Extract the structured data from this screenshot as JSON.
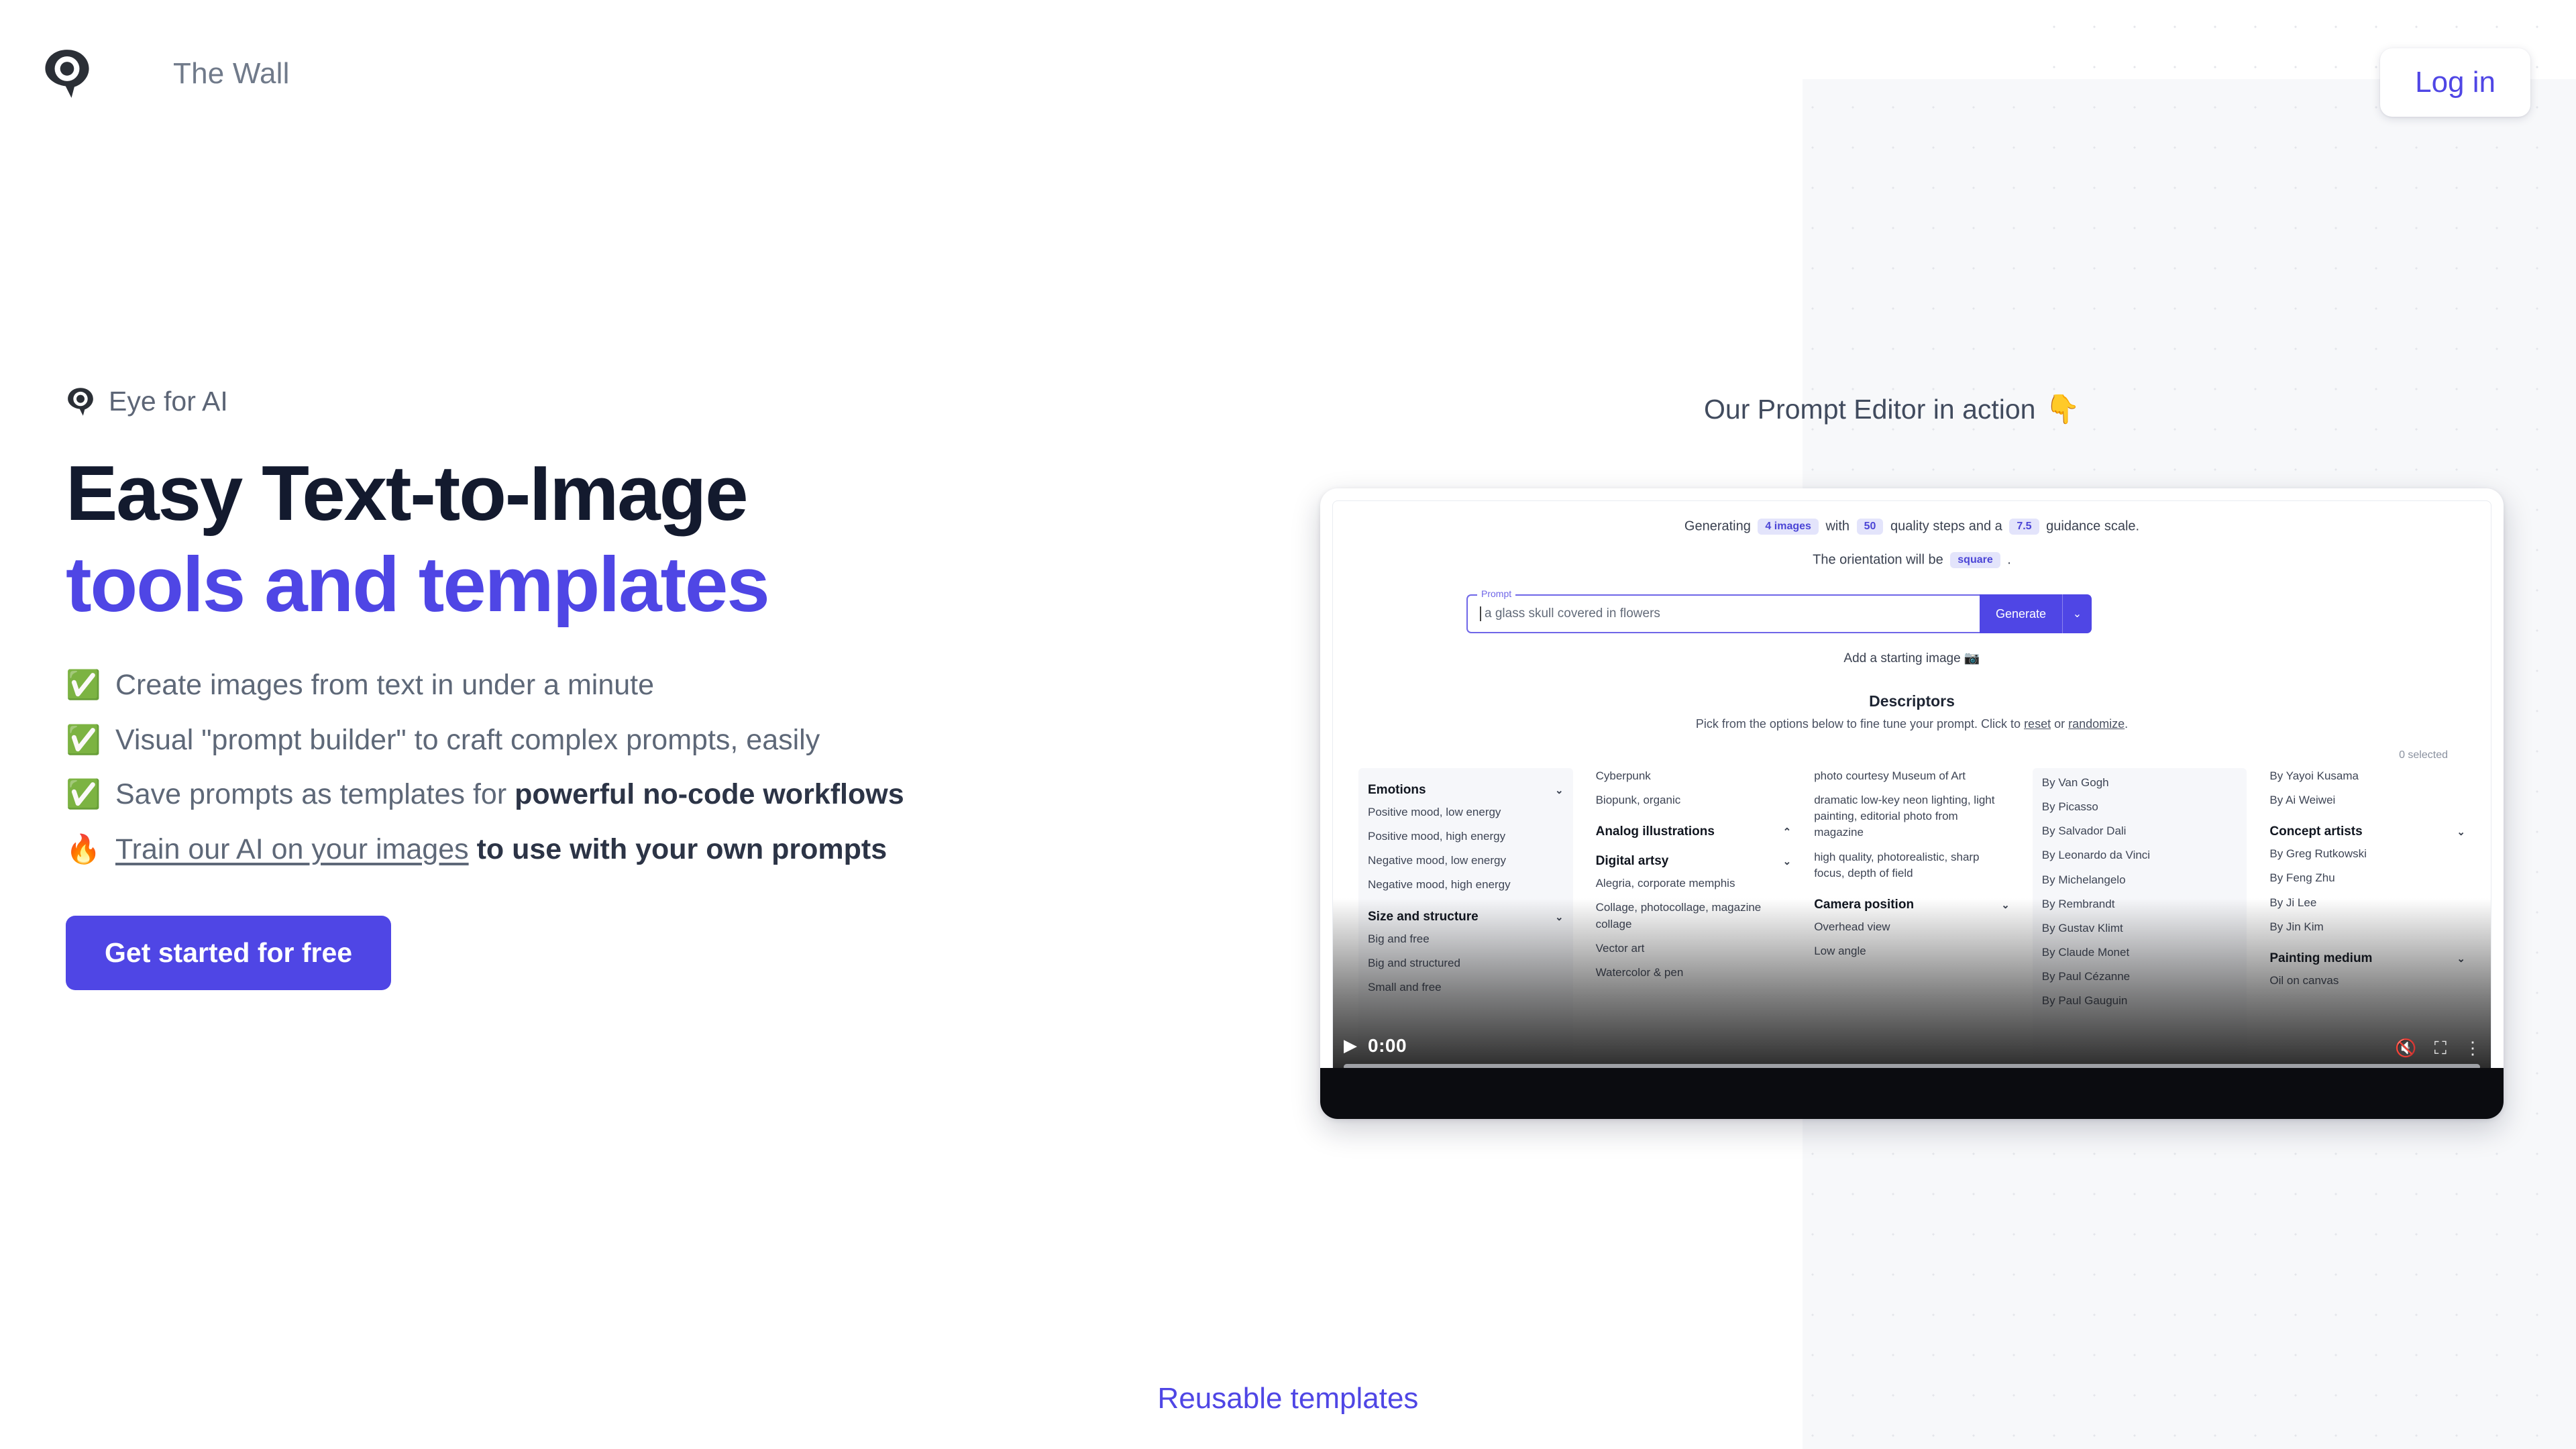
{
  "header": {
    "brand_name": "The Wall",
    "logo_icon": "eye-logo-icon",
    "login_label": "Log in"
  },
  "hero": {
    "eyebrow": "Eye for AI",
    "headline_line1": "Easy Text-to-Image",
    "headline_line2": "tools and templates",
    "bullets": [
      {
        "mark": "✅",
        "mark_icon": "check-mark-icon",
        "html": "Create images from text in under a minute"
      },
      {
        "mark": "✅",
        "mark_icon": "check-mark-icon",
        "html": "Visual \"prompt builder\" to craft complex prompts, easily"
      },
      {
        "mark": "✅",
        "mark_icon": "check-mark-icon",
        "html": "Save prompts as templates for <b>powerful no-code workflows</b>"
      },
      {
        "mark": "🔥",
        "mark_icon": "fire-icon",
        "html": "<u>Train our AI on your images</u> <b>to use with your own prompts</b>"
      }
    ],
    "cta_label": "Get started for free"
  },
  "video": {
    "caption": "Our Prompt Editor in action",
    "caption_pointer": "👇",
    "time": "0:00",
    "play_icon": "play-icon",
    "mute_icon": "mute-icon",
    "fullscreen_icon": "fullscreen-icon",
    "more_icon": "more-vertical-icon",
    "editor": {
      "gen_pre": "Generating",
      "gen_images": "4 images",
      "gen_mid": "with",
      "gen_steps": "50",
      "gen_post": "quality steps and a",
      "gen_guidance": "7.5",
      "gen_end": "guidance scale.",
      "orient_pre": "The orientation will be",
      "orient_value": "square",
      "orient_end": ".",
      "prompt_label": "Prompt",
      "prompt_value": "a glass skull covered in flowers",
      "generate_label": "Generate",
      "generate_caret": "⌄",
      "starting_image": "Add a starting image 📷",
      "descriptors_title": "Descriptors",
      "descriptors_sub_pre": "Pick from the options below to fine tune your prompt. Click to ",
      "descriptors_reset": "reset",
      "descriptors_or": " or ",
      "descriptors_randomize": "randomize",
      "descriptors_end": ".",
      "selected_count": "0 selected",
      "columns": [
        {
          "shaded": true,
          "blocks": [
            {
              "type": "group",
              "label": "Emotions",
              "chev": "⌄"
            },
            {
              "type": "opt",
              "label": "Positive mood, low energy"
            },
            {
              "type": "opt",
              "label": "Positive mood, high energy"
            },
            {
              "type": "opt",
              "label": "Negative mood, low energy"
            },
            {
              "type": "opt",
              "label": "Negative mood, high energy"
            },
            {
              "type": "group",
              "label": "Size and structure",
              "chev": "⌄"
            },
            {
              "type": "opt",
              "label": "Big and free"
            },
            {
              "type": "opt",
              "label": "Big and structured"
            },
            {
              "type": "opt",
              "label": "Small and free"
            }
          ]
        },
        {
          "shaded": false,
          "blocks": [
            {
              "type": "opt",
              "label": "Cyberpunk"
            },
            {
              "type": "opt",
              "label": "Biopunk, organic"
            },
            {
              "type": "group",
              "label": "Analog illustrations",
              "chev": "⌃"
            },
            {
              "type": "group",
              "label": "Digital artsy",
              "chev": "⌄"
            },
            {
              "type": "opt",
              "label": "Alegria, corporate memphis"
            },
            {
              "type": "opt",
              "label": "Collage, photocollage, magazine collage"
            },
            {
              "type": "opt",
              "label": "Vector art"
            },
            {
              "type": "opt",
              "label": "Watercolor & pen"
            }
          ]
        },
        {
          "shaded": false,
          "blocks": [
            {
              "type": "opt",
              "label": "photo courtesy Museum of Art"
            },
            {
              "type": "opt",
              "label": "dramatic low-key neon lighting, light painting, editorial photo from magazine"
            },
            {
              "type": "opt",
              "label": "high quality, photorealistic, sharp focus, depth of field"
            },
            {
              "type": "group",
              "label": "Camera position",
              "chev": "⌄"
            },
            {
              "type": "opt",
              "label": "Overhead view"
            },
            {
              "type": "opt",
              "label": "Low angle"
            }
          ]
        },
        {
          "shaded": true,
          "blocks": [
            {
              "type": "opt",
              "label": "By Van Gogh"
            },
            {
              "type": "opt",
              "label": "By Picasso"
            },
            {
              "type": "opt",
              "label": "By Salvador Dali"
            },
            {
              "type": "opt",
              "label": "By Leonardo da Vinci"
            },
            {
              "type": "opt",
              "label": "By Michelangelo"
            },
            {
              "type": "opt",
              "label": "By Rembrandt"
            },
            {
              "type": "opt",
              "label": "By Gustav Klimt"
            },
            {
              "type": "opt",
              "label": "By Claude Monet"
            },
            {
              "type": "opt",
              "label": "By Paul Cézanne"
            },
            {
              "type": "opt",
              "label": "By Paul Gauguin"
            }
          ]
        },
        {
          "shaded": false,
          "blocks": [
            {
              "type": "opt",
              "label": "By Yayoi Kusama"
            },
            {
              "type": "opt",
              "label": "By Ai Weiwei"
            },
            {
              "type": "group",
              "label": "Concept artists",
              "chev": "⌄"
            },
            {
              "type": "opt",
              "label": "By Greg Rutkowski"
            },
            {
              "type": "opt",
              "label": "By Feng Zhu"
            },
            {
              "type": "opt",
              "label": "By Ji Lee"
            },
            {
              "type": "opt",
              "label": "By Jin Kim"
            },
            {
              "type": "group",
              "label": "Painting medium",
              "chev": "⌄"
            },
            {
              "type": "opt",
              "label": "Oil on canvas"
            }
          ]
        }
      ]
    }
  },
  "footer": {
    "link": "Reusable templates"
  },
  "colors": {
    "accent": "#4f46e5",
    "headline_dark": "#131a2e",
    "muted": "#5e6878",
    "panel": "#f7f8fa"
  }
}
